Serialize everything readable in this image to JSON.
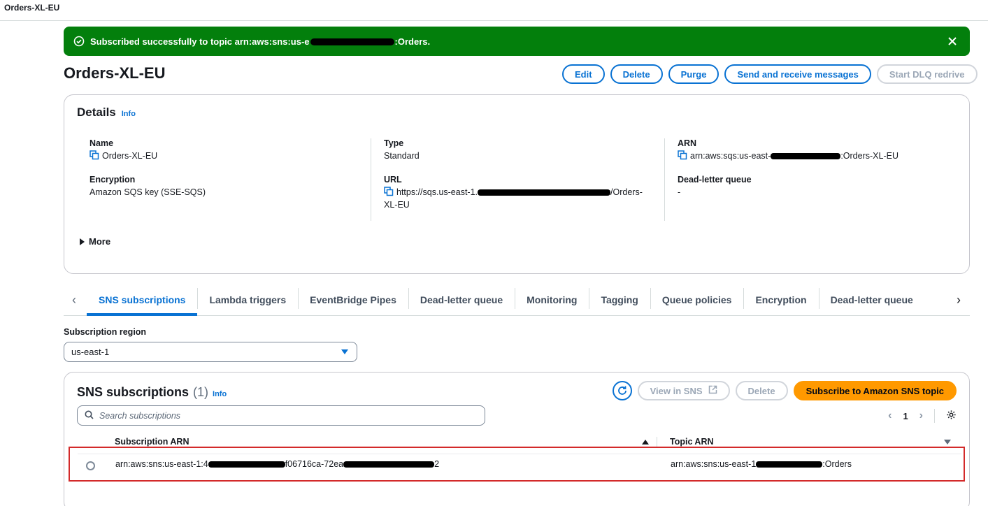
{
  "window": {
    "title": "Orders-XL-EU"
  },
  "flash": {
    "message_prefix": "Subscribed successfully to topic arn:aws:sns:us-e",
    "message_suffix": ":Orders.",
    "color": "#037f0c"
  },
  "page": {
    "title": "Orders-XL-EU"
  },
  "header_buttons": {
    "edit": "Edit",
    "delete": "Delete",
    "purge": "Purge",
    "send_receive": "Send and receive messages",
    "start_dlq": "Start DLQ redrive"
  },
  "details": {
    "heading": "Details",
    "info": "Info",
    "name_label": "Name",
    "name_value": "Orders-XL-EU",
    "type_label": "Type",
    "type_value": "Standard",
    "arn_label": "ARN",
    "arn_prefix": "arn:aws:sqs:us-east-",
    "arn_suffix": ":Orders-XL-EU",
    "encryption_label": "Encryption",
    "encryption_value": "Amazon SQS key (SSE-SQS)",
    "url_label": "URL",
    "url_prefix": "https://sqs.us-east-1.",
    "url_suffix": "/Orders-",
    "url_line2": "XL-EU",
    "dlq_label": "Dead-letter queue",
    "dlq_value": "-",
    "more": "More"
  },
  "tabs": [
    {
      "label": "SNS subscriptions",
      "active": true
    },
    {
      "label": "Lambda triggers"
    },
    {
      "label": "EventBridge Pipes"
    },
    {
      "label": "Dead-letter queue"
    },
    {
      "label": "Monitoring"
    },
    {
      "label": "Tagging"
    },
    {
      "label": "Queue policies"
    },
    {
      "label": "Encryption"
    },
    {
      "label": "Dead-letter queue"
    }
  ],
  "region": {
    "label": "Subscription region",
    "value": "us-east-1"
  },
  "sns": {
    "heading": "SNS subscriptions",
    "count": "(1)",
    "info": "Info",
    "view_in_sns": "View in SNS",
    "delete": "Delete",
    "subscribe": "Subscribe to Amazon SNS topic",
    "search_placeholder": "Search subscriptions",
    "page": "1",
    "columns": {
      "subscription_arn": "Subscription ARN",
      "topic_arn": "Topic ARN"
    },
    "rows": [
      {
        "sub_prefix": "arn:aws:sns:us-east-1:4",
        "sub_mid": "f06716ca-72ea",
        "sub_suffix": "2",
        "topic_prefix": "arn:aws:sns:us-east-1",
        "topic_suffix": ":Orders"
      }
    ]
  },
  "colors": {
    "accent": "#0972d3",
    "primary_button": "#ff9900",
    "highlight_border": "#d32a2a"
  }
}
